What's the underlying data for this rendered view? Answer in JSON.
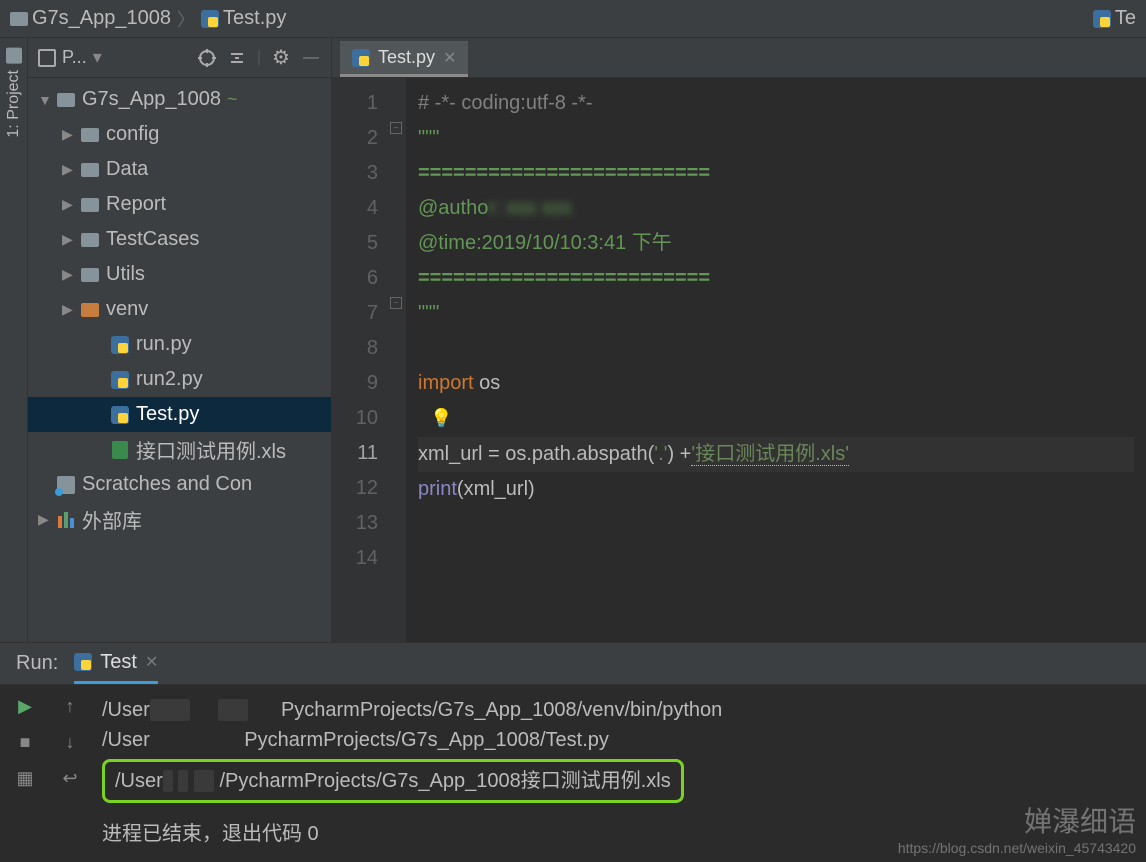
{
  "breadcrumb": {
    "project": "G7s_App_1008",
    "file": "Test.py",
    "right": "Te"
  },
  "side_tab": {
    "label": "1: Project"
  },
  "project_panel": {
    "title": "P...",
    "tools": {
      "collapse": "⊕",
      "expand": "⇱",
      "gear": "⚙"
    }
  },
  "tree": [
    {
      "depth": 0,
      "expanded": true,
      "icon": "dir",
      "label": "G7s_App_1008",
      "vcs": "~"
    },
    {
      "depth": 1,
      "expanded": false,
      "icon": "dir",
      "label": "config"
    },
    {
      "depth": 1,
      "expanded": false,
      "icon": "dir",
      "label": "Data"
    },
    {
      "depth": 1,
      "expanded": false,
      "icon": "dir",
      "label": "Report"
    },
    {
      "depth": 1,
      "expanded": false,
      "icon": "dir",
      "label": "TestCases"
    },
    {
      "depth": 1,
      "expanded": false,
      "icon": "dir",
      "label": "Utils"
    },
    {
      "depth": 1,
      "expanded": false,
      "icon": "dir-orange",
      "label": "venv"
    },
    {
      "depth": 2,
      "icon": "py",
      "label": "run.py"
    },
    {
      "depth": 2,
      "icon": "py",
      "label": "run2.py"
    },
    {
      "depth": 2,
      "icon": "py",
      "label": "Test.py",
      "selected": true
    },
    {
      "depth": 2,
      "icon": "xls",
      "label": "接口测试用例.xls"
    },
    {
      "depth": 0,
      "icon": "scratch",
      "label": "Scratches and Con"
    },
    {
      "depth": 0,
      "expanded": false,
      "icon": "lib",
      "label": "外部库"
    }
  ],
  "editor": {
    "tab_name": "Test.py",
    "lines": [
      {
        "n": 1,
        "cls": "c-comment",
        "text": "# -*- coding:utf-8 -*-"
      },
      {
        "n": 2,
        "cls": "c-docstr",
        "text": "\"\"\""
      },
      {
        "n": 3,
        "cls": "c-docsep",
        "text": "========================="
      },
      {
        "n": 4,
        "cls": "c-docstr",
        "text": "@autho",
        "blur_after": "r: xxx xxx"
      },
      {
        "n": 5,
        "cls": "c-docstr",
        "text": "@time:2019/10/10:3:41 下午"
      },
      {
        "n": 6,
        "cls": "c-docsep",
        "text": "========================="
      },
      {
        "n": 7,
        "cls": "c-docstr",
        "text": "\"\"\""
      },
      {
        "n": 8,
        "cls": "",
        "text": ""
      },
      {
        "n": 9,
        "segments": [
          {
            "cls": "c-keyword",
            "t": "import "
          },
          {
            "cls": "",
            "t": "os"
          }
        ]
      },
      {
        "n": 10,
        "bulb": true
      },
      {
        "n": 11,
        "current": true,
        "segments": [
          {
            "cls": "",
            "t": "xml_url = os.path."
          },
          {
            "cls": "",
            "t": "abspath("
          },
          {
            "cls": "c-string",
            "t": "'.'"
          },
          {
            "cls": "",
            "t": ") +"
          },
          {
            "cls": "c-string c-warn",
            "t": "'接口测试用例.xls'"
          }
        ]
      },
      {
        "n": 12,
        "segments": [
          {
            "cls": "c-builtin",
            "t": "print"
          },
          {
            "cls": "",
            "t": "(xml_url)"
          }
        ]
      },
      {
        "n": 13,
        "cls": "",
        "text": ""
      },
      {
        "n": 14,
        "cls": "",
        "text": ""
      }
    ]
  },
  "run": {
    "label": "Run:",
    "config": "Test",
    "output1_pre": "/User",
    "output1_post": "PycharmProjects/G7s_App_1008/venv/bin/python",
    "output2_pre": "/User",
    "output2_post": "PycharmProjects/G7s_App_1008/Test.py",
    "highlight_pre": "/User",
    "highlight_post": "/PycharmProjects/G7s_App_1008接口测试用例.xls",
    "exit_msg": "进程已结束，退出代码 0"
  },
  "watermark": {
    "title": "婵瀑细语",
    "url": "https://blog.csdn.net/weixin_45743420"
  }
}
